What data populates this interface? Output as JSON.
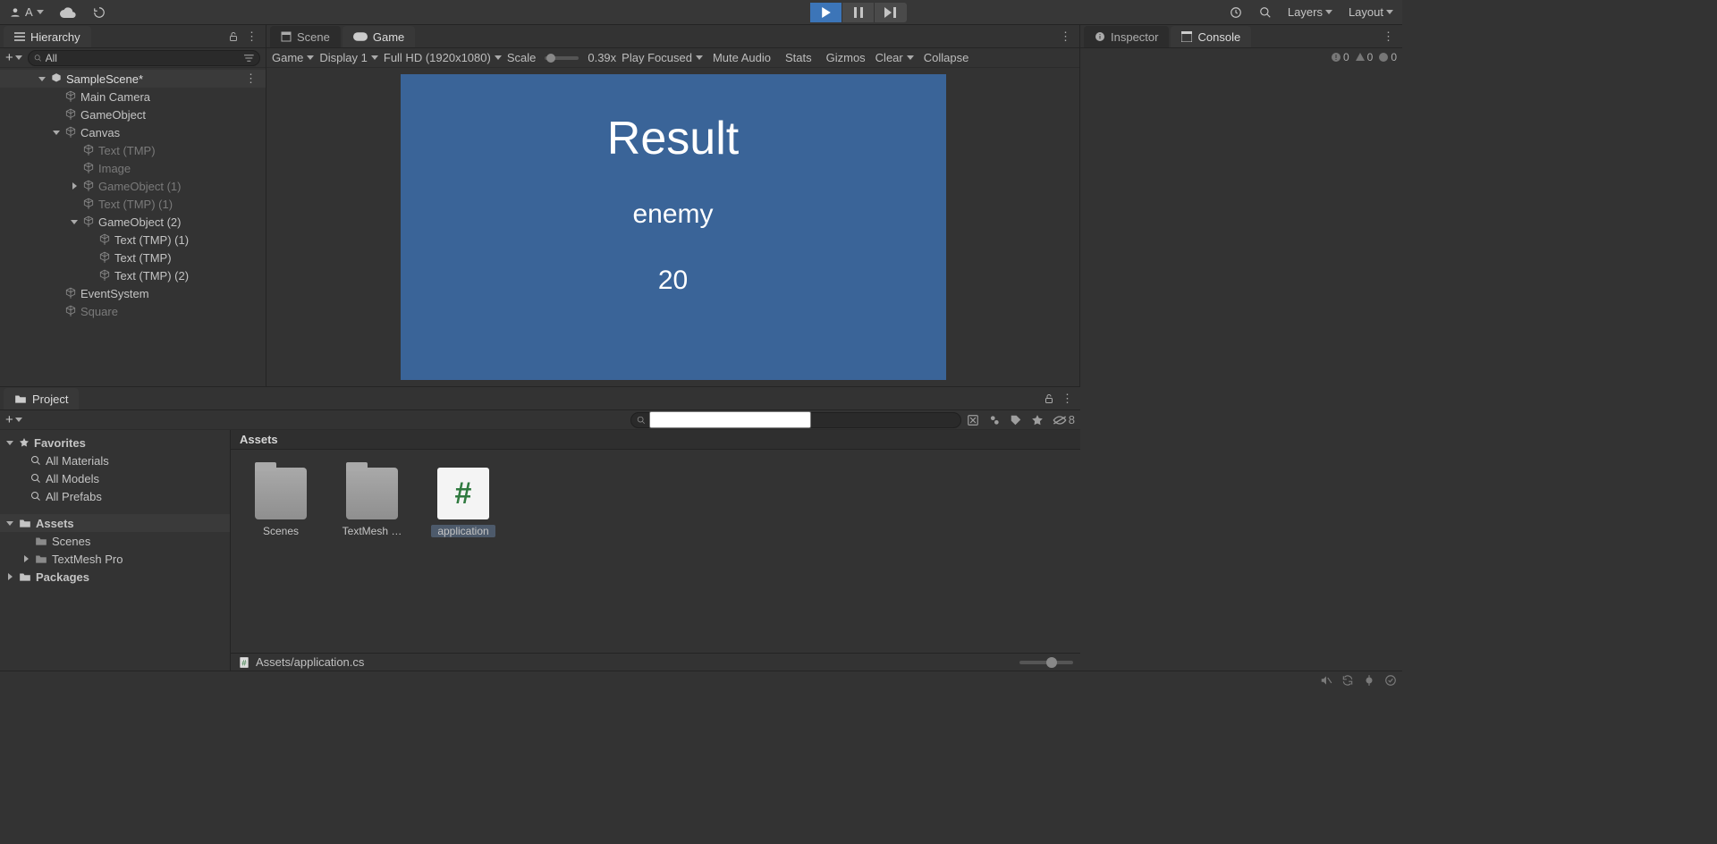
{
  "topbar": {
    "account_label": "A",
    "layers_label": "Layers",
    "layout_label": "Layout"
  },
  "hierarchy": {
    "tab": "Hierarchy",
    "search_value": "All",
    "scene": "SampleScene*",
    "items": [
      {
        "label": "Main Camera",
        "indent": "ind2",
        "fold": "",
        "dim": false
      },
      {
        "label": "GameObject",
        "indent": "ind2",
        "fold": "",
        "dim": false
      },
      {
        "label": "Canvas",
        "indent": "ind2",
        "fold": "down",
        "dim": false
      },
      {
        "label": "Text (TMP)",
        "indent": "ind3",
        "fold": "",
        "dim": true
      },
      {
        "label": "Image",
        "indent": "ind3",
        "fold": "",
        "dim": true
      },
      {
        "label": "GameObject (1)",
        "indent": "ind3",
        "fold": "right",
        "dim": true
      },
      {
        "label": "Text (TMP) (1)",
        "indent": "ind3",
        "fold": "",
        "dim": true
      },
      {
        "label": "GameObject (2)",
        "indent": "ind3",
        "fold": "down",
        "dim": false
      },
      {
        "label": "Text (TMP) (1)",
        "indent": "ind4",
        "fold": "",
        "dim": false
      },
      {
        "label": "Text (TMP)",
        "indent": "ind4",
        "fold": "",
        "dim": false
      },
      {
        "label": "Text (TMP) (2)",
        "indent": "ind4",
        "fold": "",
        "dim": false
      },
      {
        "label": "EventSystem",
        "indent": "ind2",
        "fold": "",
        "dim": false
      },
      {
        "label": "Square",
        "indent": "ind2",
        "fold": "",
        "dim": true
      }
    ]
  },
  "game": {
    "tabs": {
      "scene": "Scene",
      "game": "Game"
    },
    "toolbar": {
      "mode": "Game",
      "display": "Display 1",
      "resolution": "Full HD (1920x1080)",
      "scale_label": "Scale",
      "scale_value": "0.39x",
      "play_focused": "Play Focused",
      "mute": "Mute Audio",
      "stats": "Stats",
      "gizmos": "Gizmos",
      "clear": "Clear",
      "collapse": "Collapse"
    },
    "view": {
      "title": "Result",
      "subtitle": "enemy",
      "value": "20"
    },
    "counts": {
      "errors": "0",
      "warnings": "0",
      "info": "0"
    }
  },
  "right": {
    "tabs": {
      "inspector": "Inspector",
      "console": "Console"
    }
  },
  "project": {
    "tab": "Project",
    "toolbar": {
      "hidden_count": "8"
    },
    "tree": {
      "favorites": "Favorites",
      "fav_items": [
        "All Materials",
        "All Models",
        "All Prefabs"
      ],
      "assets": "Assets",
      "asset_items": [
        "Scenes",
        "TextMesh Pro"
      ],
      "packages": "Packages"
    },
    "breadcrumb": "Assets",
    "items": [
      {
        "name": "Scenes",
        "kind": "folder",
        "sel": false
      },
      {
        "name": "TextMesh …",
        "kind": "folder",
        "sel": false
      },
      {
        "name": "application",
        "kind": "script",
        "sel": true
      }
    ],
    "footer_path": "Assets/application.cs"
  }
}
